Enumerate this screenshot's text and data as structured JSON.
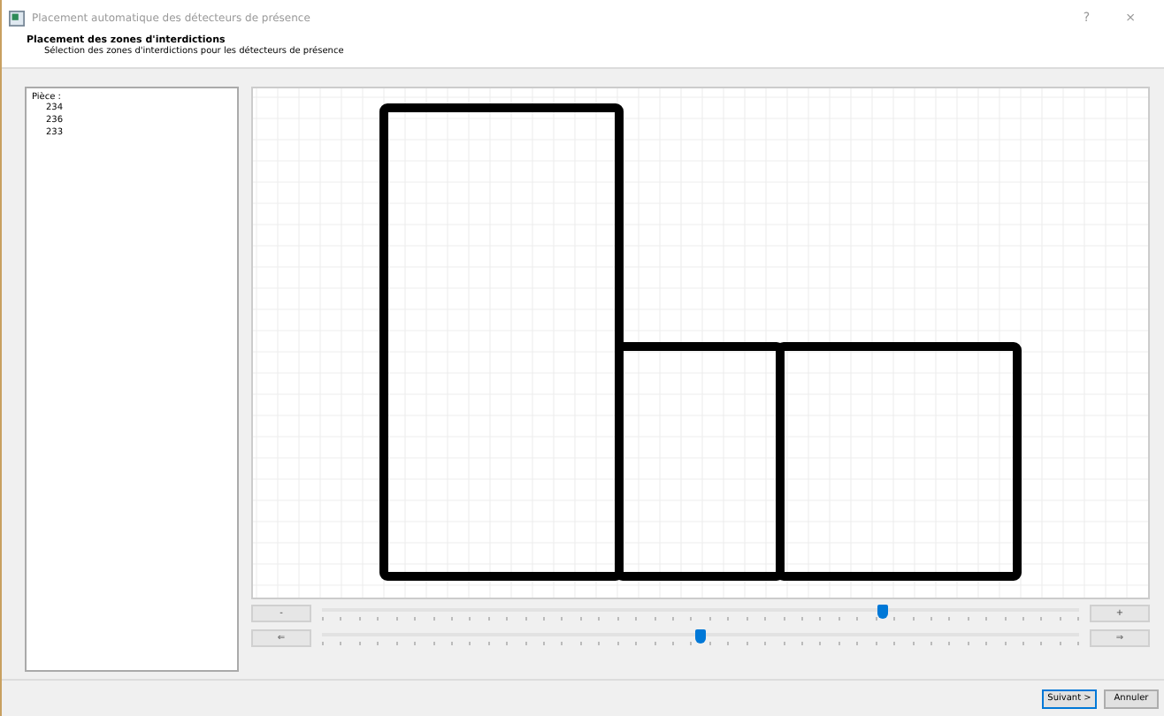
{
  "window": {
    "title": "Placement automatique des détecteurs de présence",
    "help": "?",
    "close": "×"
  },
  "header": {
    "title": "Placement des zones d'interdictions",
    "subtitle": "Sélection des zones d'interdictions pour les détecteurs de présence"
  },
  "room_list": {
    "label": "Pièce :",
    "items": [
      {
        "label": "234",
        "selected": false
      },
      {
        "label": "236",
        "selected": false
      },
      {
        "label": "233",
        "selected": false
      }
    ]
  },
  "sliders": [
    {
      "left": "-",
      "right": "+",
      "level": 0.74
    },
    {
      "left": "⇐",
      "right": "⇒",
      "level": 0.5
    }
  ],
  "buttons": [
    {
      "label": "Suivant >",
      "kind": "default"
    },
    {
      "label": "Annuler",
      "kind": "normal"
    }
  ]
}
